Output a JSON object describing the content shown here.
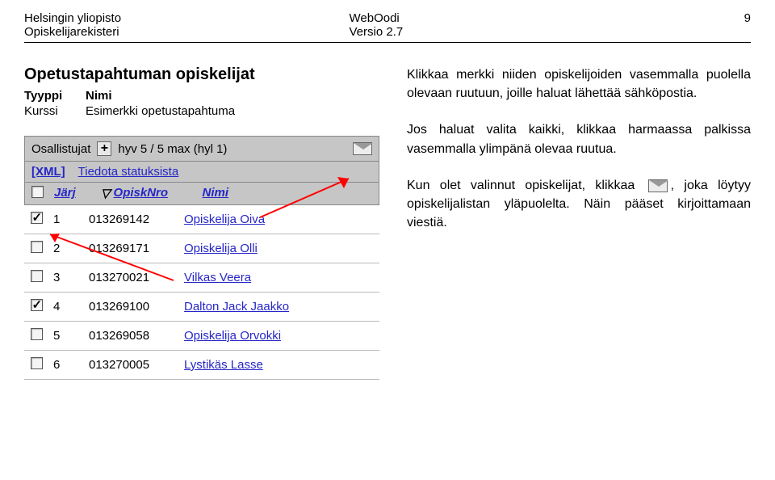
{
  "header": {
    "left_line1": "Helsingin yliopisto",
    "left_line2": "Opiskelijarekisteri",
    "center_line1": "WebOodi",
    "center_line2": "Versio 2.7",
    "page_number": "9"
  },
  "panel": {
    "section_title": "Opetustapahtuman opiskelijat",
    "type_label": "Tyyppi",
    "name_label": "Nimi",
    "type_value": "Kurssi",
    "name_value": "Esimerkki opetustapahtuma",
    "participants_label": "Osallistujat",
    "participants_count": "hyv 5 / 5 max (hyl 1)",
    "xml_link": "[XML]",
    "status_link": "Tiedota statuksista",
    "col_jarj": "Järj",
    "col_opisnro": "OpiskNro",
    "col_nimi": "Nimi",
    "rows": [
      {
        "checked": true,
        "n": "1",
        "id": "013269142",
        "name": "Opiskelija Oiva"
      },
      {
        "checked": false,
        "n": "2",
        "id": "013269171",
        "name": "Opiskelija Olli"
      },
      {
        "checked": false,
        "n": "3",
        "id": "013270021",
        "name": "Vilkas Veera"
      },
      {
        "checked": true,
        "n": "4",
        "id": "013269100",
        "name": "Dalton Jack Jaakko"
      },
      {
        "checked": false,
        "n": "5",
        "id": "013269058",
        "name": "Opiskelija Orvokki"
      },
      {
        "checked": false,
        "n": "6",
        "id": "013270005",
        "name": "Lystikäs Lasse"
      }
    ]
  },
  "text": {
    "para1": "Klikkaa merkki niiden opiskelijoiden vasemmalla puolella olevaan ruutuun, joille haluat lähettää sähköpostia.",
    "para2": "Jos haluat valita kaikki, klikkaa harmaassa palkissa vasemmalla ylimpänä olevaa ruutua.",
    "para3a": "Kun olet valinnut opiskelijat, klikkaa",
    "para3b": ", joka löytyy opiskelijalistan yläpuolelta. Näin pääset kirjoittamaan viestiä."
  }
}
